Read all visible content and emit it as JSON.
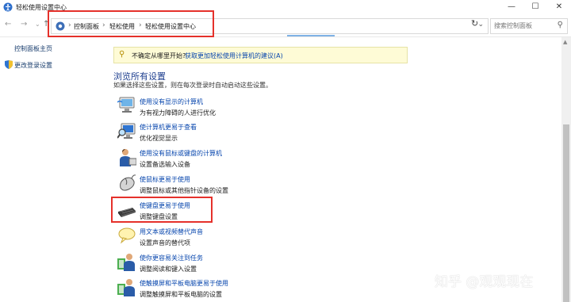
{
  "window": {
    "title": "轻松使用设置中心"
  },
  "nav": {
    "breadcrumb": [
      "控制面板",
      "轻松使用",
      "轻松使用设置中心"
    ],
    "search_placeholder": "搜索控制面板"
  },
  "sidebar": {
    "items": [
      {
        "label": "控制面板主页"
      },
      {
        "label": "更改登录设置"
      }
    ]
  },
  "info": {
    "question": "不确定从哪里开始?",
    "link": "获取更加轻松使用计算机的建议(A)"
  },
  "main": {
    "heading": "浏览所有设置",
    "subtitle": "如果选择这些设置，则在每次登录时自动启动这些设置。",
    "items": [
      {
        "title": "使用没有显示的计算机",
        "desc": "为有视力障碍的人进行优化",
        "icon": "monitor-narrator-icon"
      },
      {
        "title": "使计算机更易于查看",
        "desc": "优化视觉显示",
        "icon": "magnifier-monitor-icon"
      },
      {
        "title": "使用没有鼠标或键盘的计算机",
        "desc": "设置备选输入设备",
        "icon": "person-onscreen-keyboard-icon"
      },
      {
        "title": "使鼠标更易于使用",
        "desc": "调整鼠标或其他指针设备的设置",
        "icon": "mouse-icon"
      },
      {
        "title": "使键盘更易于使用",
        "desc": "调整键盘设置",
        "icon": "keyboard-icon"
      },
      {
        "title": "用文本或视频替代声音",
        "desc": "设置声音的替代项",
        "icon": "speech-bubble-icon"
      },
      {
        "title": "使你更容易关注到任务",
        "desc": "调整阅读和键入设置",
        "icon": "person-focus-icon"
      },
      {
        "title": "使触摸屏和平板电脑更易于使用",
        "desc": "调整触摸屏和平板电脑的设置",
        "icon": "person-tablet-icon"
      }
    ]
  },
  "watermark": {
    "text": "知乎 @观观现在"
  },
  "colors": {
    "highlight_box": "#e5312b",
    "link": "#0645ad",
    "heading": "#1e3f8f",
    "info_bg": "#fefbd6"
  }
}
